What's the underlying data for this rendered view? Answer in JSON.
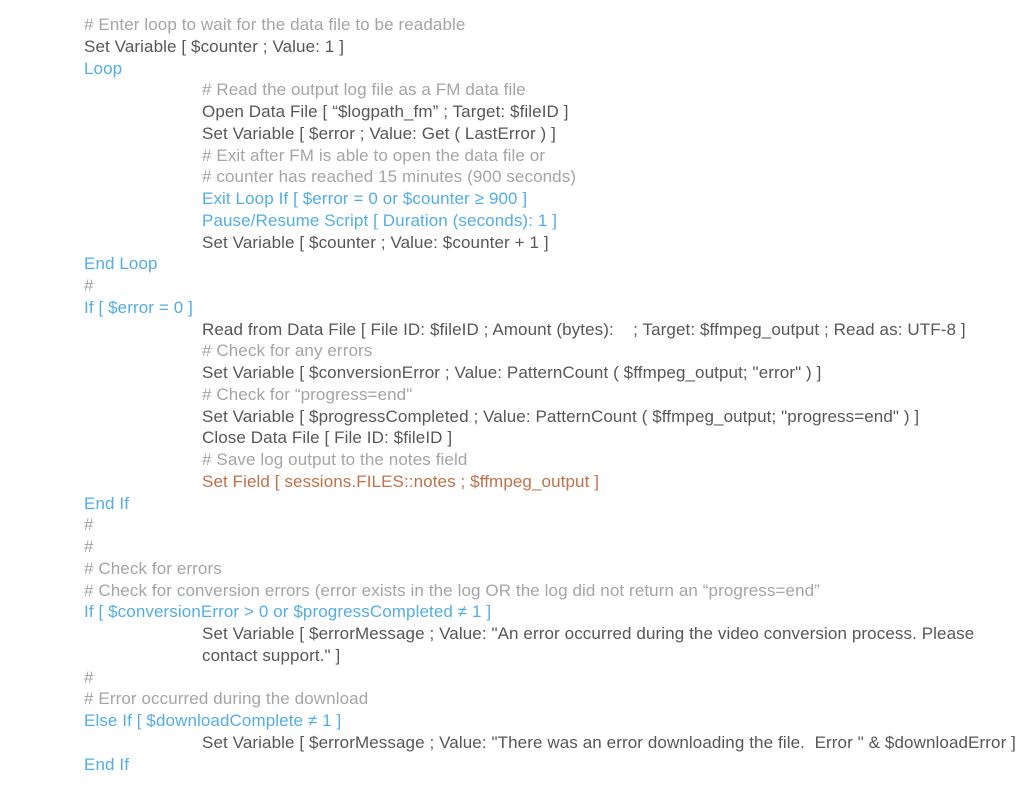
{
  "lines": [
    {
      "indent": false,
      "color": "gray-light",
      "text": "# Enter loop to wait for the data file to be readable"
    },
    {
      "indent": false,
      "color": "gray-dark",
      "text": "Set Variable [ $counter ; Value: 1 ]"
    },
    {
      "indent": false,
      "color": "blue",
      "text": "Loop"
    },
    {
      "indent": true,
      "color": "gray-light",
      "text": "# Read the output log file as a FM data file"
    },
    {
      "indent": true,
      "color": "gray-dark",
      "text": "Open Data File [ “$logpath_fm” ; Target: $fileID ]"
    },
    {
      "indent": true,
      "color": "gray-dark",
      "text": "Set Variable [ $error ; Value: Get ( LastError ) ]"
    },
    {
      "indent": true,
      "color": "gray-light",
      "text": "# Exit after FM is able to open the data file or"
    },
    {
      "indent": true,
      "color": "gray-light",
      "text": "# counter has reached 15 minutes (900 seconds)"
    },
    {
      "indent": true,
      "color": "blue",
      "text": "Exit Loop If [ $error = 0 or $counter ≥ 900 ]"
    },
    {
      "indent": true,
      "color": "blue",
      "text": "Pause/Resume Script [ Duration (seconds): 1 ]"
    },
    {
      "indent": true,
      "color": "gray-dark",
      "text": "Set Variable [ $counter ; Value: $counter + 1 ]"
    },
    {
      "indent": false,
      "color": "blue",
      "text": "End Loop"
    },
    {
      "indent": false,
      "color": "gray-light",
      "text": "#"
    },
    {
      "indent": false,
      "color": "blue",
      "text": "If [ $error = 0 ]"
    },
    {
      "indent": true,
      "color": "gray-dark",
      "text": "Read from Data File [ File ID: $fileID ; Amount (bytes):    ; Target: $ffmpeg_output ; Read as: UTF-8 ]"
    },
    {
      "indent": true,
      "color": "gray-light",
      "text": "# Check for any errors"
    },
    {
      "indent": true,
      "color": "gray-dark",
      "text": "Set Variable [ $conversionError ; Value: PatternCount ( $ffmpeg_output; \"error\" ) ]"
    },
    {
      "indent": true,
      "color": "gray-light",
      "text": "# Check for “progress=end\""
    },
    {
      "indent": true,
      "color": "gray-dark",
      "text": "Set Variable [ $progressCompleted ; Value: PatternCount ( $ffmpeg_output; \"progress=end\" ) ]"
    },
    {
      "indent": true,
      "color": "gray-dark",
      "text": "Close Data File [ File ID: $fileID ]"
    },
    {
      "indent": true,
      "color": "gray-light",
      "text": "# Save log output to the notes field"
    },
    {
      "indent": true,
      "color": "orange",
      "text": "Set Field [ sessions.FILES::notes ; $ffmpeg_output ]"
    },
    {
      "indent": false,
      "color": "blue",
      "text": "End If"
    },
    {
      "indent": false,
      "color": "gray-light",
      "text": "#"
    },
    {
      "indent": false,
      "color": "gray-light",
      "text": "#"
    },
    {
      "indent": false,
      "color": "gray-light",
      "text": "# Check for errors"
    },
    {
      "indent": false,
      "color": "gray-light",
      "text": "# Check for conversion errors (error exists in the log OR the log did not return an “progress=end”"
    },
    {
      "indent": false,
      "color": "blue",
      "text": "If [ $conversionError > 0 or $progressCompleted ≠ 1 ]"
    },
    {
      "indent": true,
      "color": "gray-dark",
      "text": "Set Variable [ $errorMessage ; Value: \"An error occurred during the video conversion process. Please contact support.\" ]"
    },
    {
      "indent": false,
      "color": "gray-light",
      "text": "#"
    },
    {
      "indent": false,
      "color": "gray-light",
      "text": "# Error occurred during the download"
    },
    {
      "indent": false,
      "color": "blue",
      "text": "Else If [ $downloadComplete ≠ 1 ]"
    },
    {
      "indent": true,
      "color": "gray-dark",
      "text": "Set Variable [ $errorMessage ; Value: \"There was an error downloading the file.  Error \" & $downloadError ]"
    },
    {
      "indent": false,
      "color": "blue",
      "text": "End If"
    }
  ]
}
